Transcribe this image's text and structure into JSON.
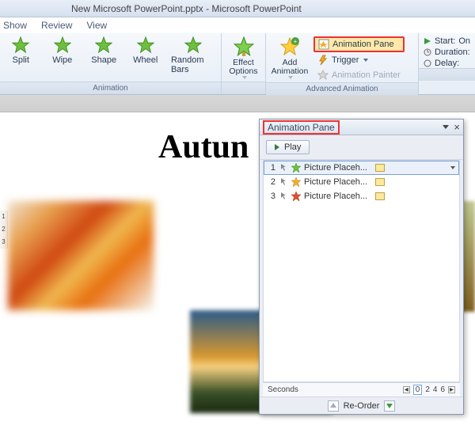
{
  "title": "New Microsoft PowerPoint.pptx - Microsoft PowerPoint",
  "tabs": {
    "show": "Show",
    "review": "Review",
    "view": "View"
  },
  "gallery": {
    "split": "Split",
    "wipe": "Wipe",
    "shape": "Shape",
    "wheel": "Wheel",
    "random": "Random Bars"
  },
  "ribbon": {
    "effect_options": "Effect\nOptions",
    "add_animation": "Add\nAnimation",
    "anim_pane": "Animation Pane",
    "trigger": "Trigger",
    "painter": "Animation Painter",
    "group_anim": "Animation",
    "group_adv": "Advanced Animation",
    "start": "Start:",
    "start_val": "On",
    "duration": "Duration:",
    "delay": "Delay:"
  },
  "slide": {
    "title": "Autun"
  },
  "thumbs": {
    "t1": "1",
    "t2": "2",
    "t3": "3"
  },
  "pane": {
    "title": "Animation Pane",
    "play": "Play",
    "items": [
      {
        "num": "1",
        "name": "Picture Placeh..."
      },
      {
        "num": "2",
        "name": "Picture Placeh..."
      },
      {
        "num": "3",
        "name": "Picture Placeh..."
      }
    ],
    "seconds": "Seconds",
    "cur": "0",
    "t2": "2",
    "t4": "4",
    "t6": "6",
    "reorder": "Re-Order"
  }
}
